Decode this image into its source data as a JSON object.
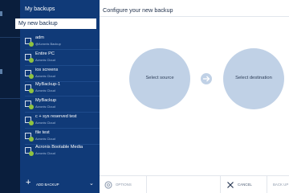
{
  "sidebar": {
    "title": "My backups",
    "new_backup_label": "My new backup",
    "items": [
      {
        "name": "adm",
        "sub": "@Acronis Backup"
      },
      {
        "name": "Entire PC",
        "sub": "Acronis Cloud"
      },
      {
        "name": "ios screens",
        "sub": "Acronis Cloud"
      },
      {
        "name": "MyBackup-1",
        "sub": "Acronis Cloud"
      },
      {
        "name": "MyBackup",
        "sub": "Acronis Cloud"
      },
      {
        "name": "c + sys reserved test",
        "sub": "Acronis Cloud"
      },
      {
        "name": "file test",
        "sub": "Acronis Cloud"
      },
      {
        "name": "Acronis Bootable Media",
        "sub": "Acronis Cloud"
      }
    ],
    "add_backup_label": "ADD BACKUP"
  },
  "main": {
    "title": "Configure your new backup",
    "select_source_label": "Select source",
    "select_destination_label": "Select destination"
  },
  "bottom_bar": {
    "options_label": "OPTIONS",
    "cancel_label": "CANCEL",
    "backup_label": "BACK UP"
  },
  "colors": {
    "rail": "#0a1e3c",
    "sidebar": "#103a78",
    "accent_circle": "#c0d1e6",
    "status_ok": "#8fc33f"
  },
  "icons": [
    "plus-icon",
    "chevron-down-icon",
    "arrow-right-icon",
    "gear-icon",
    "x-icon",
    "backup-status-icon"
  ]
}
